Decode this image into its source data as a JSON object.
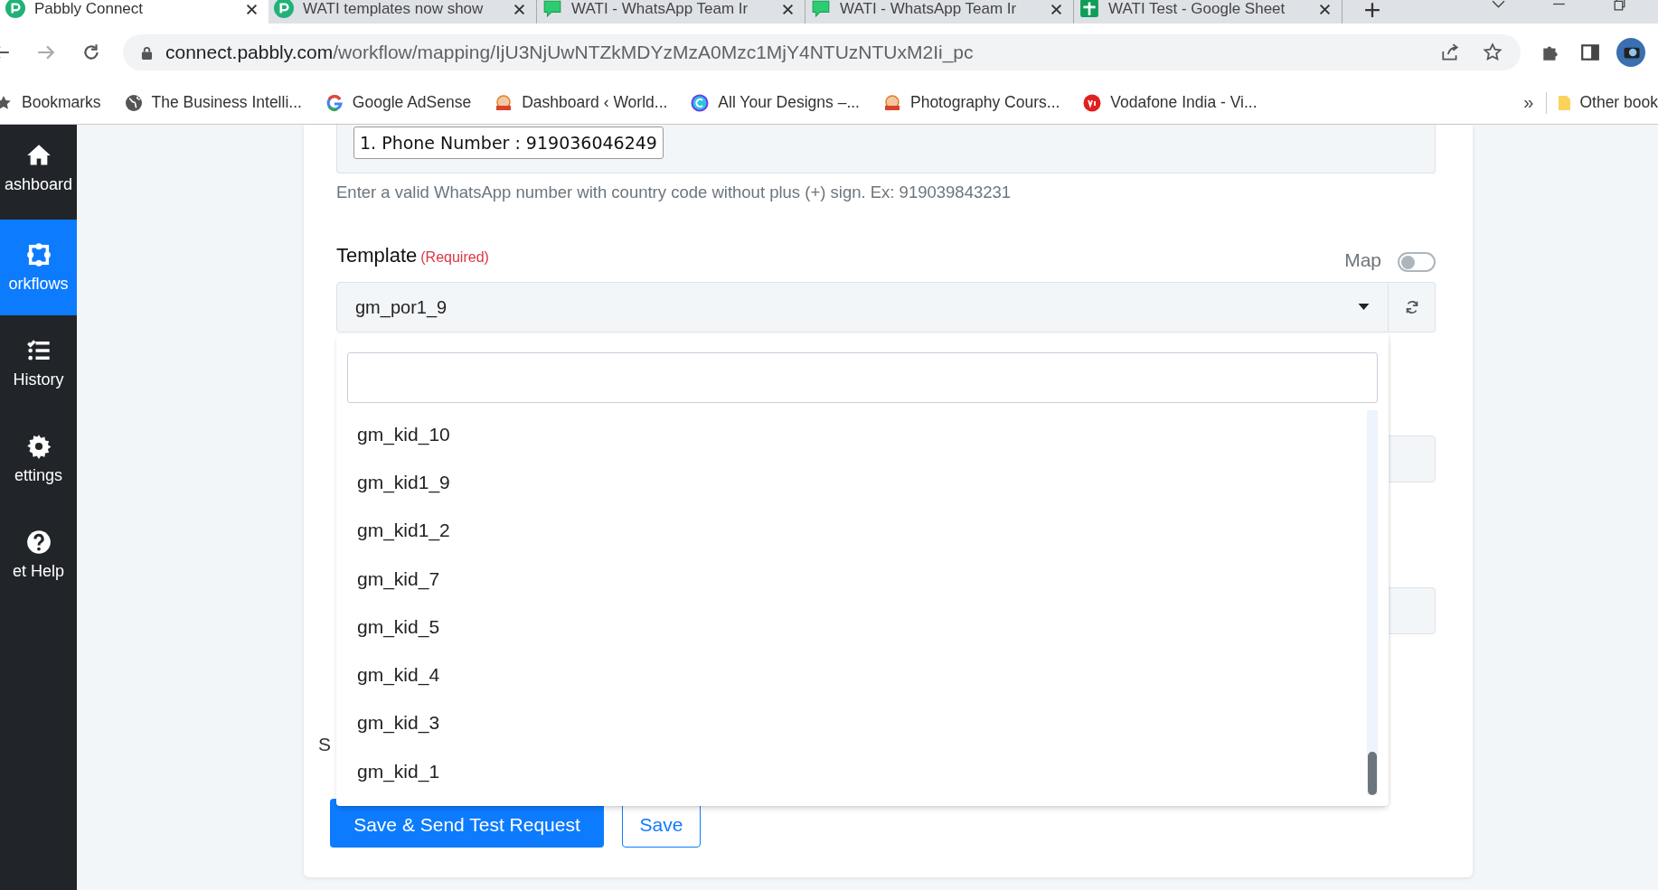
{
  "browser": {
    "tabs": [
      {
        "title": "Pabbly Connect",
        "selected": true,
        "kind": "pabbly"
      },
      {
        "title": "WATI templates now show",
        "selected": false,
        "kind": "pabbly"
      },
      {
        "title": "WATI - WhatsApp Team Ir",
        "selected": false,
        "kind": "chat"
      },
      {
        "title": "WATI - WhatsApp Team Ir",
        "selected": false,
        "kind": "chat"
      },
      {
        "title": "WATI Test - Google Sheet",
        "selected": false,
        "kind": "sheets"
      }
    ],
    "url_host": "connect.pabbly.com",
    "url_path": "/workflow/mapping/IjU3NjUwNTZkMDYzMzA0Mzc1MjY4NTUzNTUxM2Ii_pc",
    "bookmarks": [
      {
        "label": "Bookmarks",
        "kind": "star"
      },
      {
        "label": "The Business Intelli...",
        "kind": "globe"
      },
      {
        "label": "Google AdSense",
        "kind": "google"
      },
      {
        "label": "Dashboard ‹ World...",
        "kind": "badge"
      },
      {
        "label": "All Your Designs –...",
        "kind": "canva"
      },
      {
        "label": "Photography Cours...",
        "kind": "badge"
      },
      {
        "label": "Vodafone India - Vi...",
        "kind": "vi"
      }
    ],
    "bookmarks_more": "»",
    "other_bookmarks": "Other book"
  },
  "sidebar": {
    "items": [
      {
        "label": "ashboard",
        "kind": "home",
        "selected": false
      },
      {
        "label": "orkflows",
        "kind": "workflow",
        "selected": true
      },
      {
        "label": "History",
        "kind": "history",
        "selected": false
      },
      {
        "label": "ettings",
        "kind": "settings",
        "selected": false
      },
      {
        "label": "et Help",
        "kind": "help",
        "selected": false
      }
    ]
  },
  "form": {
    "phone_tag": "1. Phone Number : 919036046249",
    "phone_hint": "Enter a valid WhatsApp number with country code without plus (+) sign. Ex: 919039843231",
    "template_label": "Template",
    "template_required": "(Required)",
    "map_label": "Map",
    "map_on": false,
    "template_value": "gm_por1_9",
    "options": [
      "gm_kid_10",
      "gm_kid1_9",
      "gm_kid1_2",
      "gm_kid_7",
      "gm_kid_5",
      "gm_kid_4",
      "gm_kid_3",
      "gm_kid_1"
    ],
    "hidden_label": "S",
    "buttons": [
      {
        "label": "Save & Send Test Request",
        "kind": "primary"
      },
      {
        "label": "Save",
        "kind": "outline"
      }
    ]
  }
}
